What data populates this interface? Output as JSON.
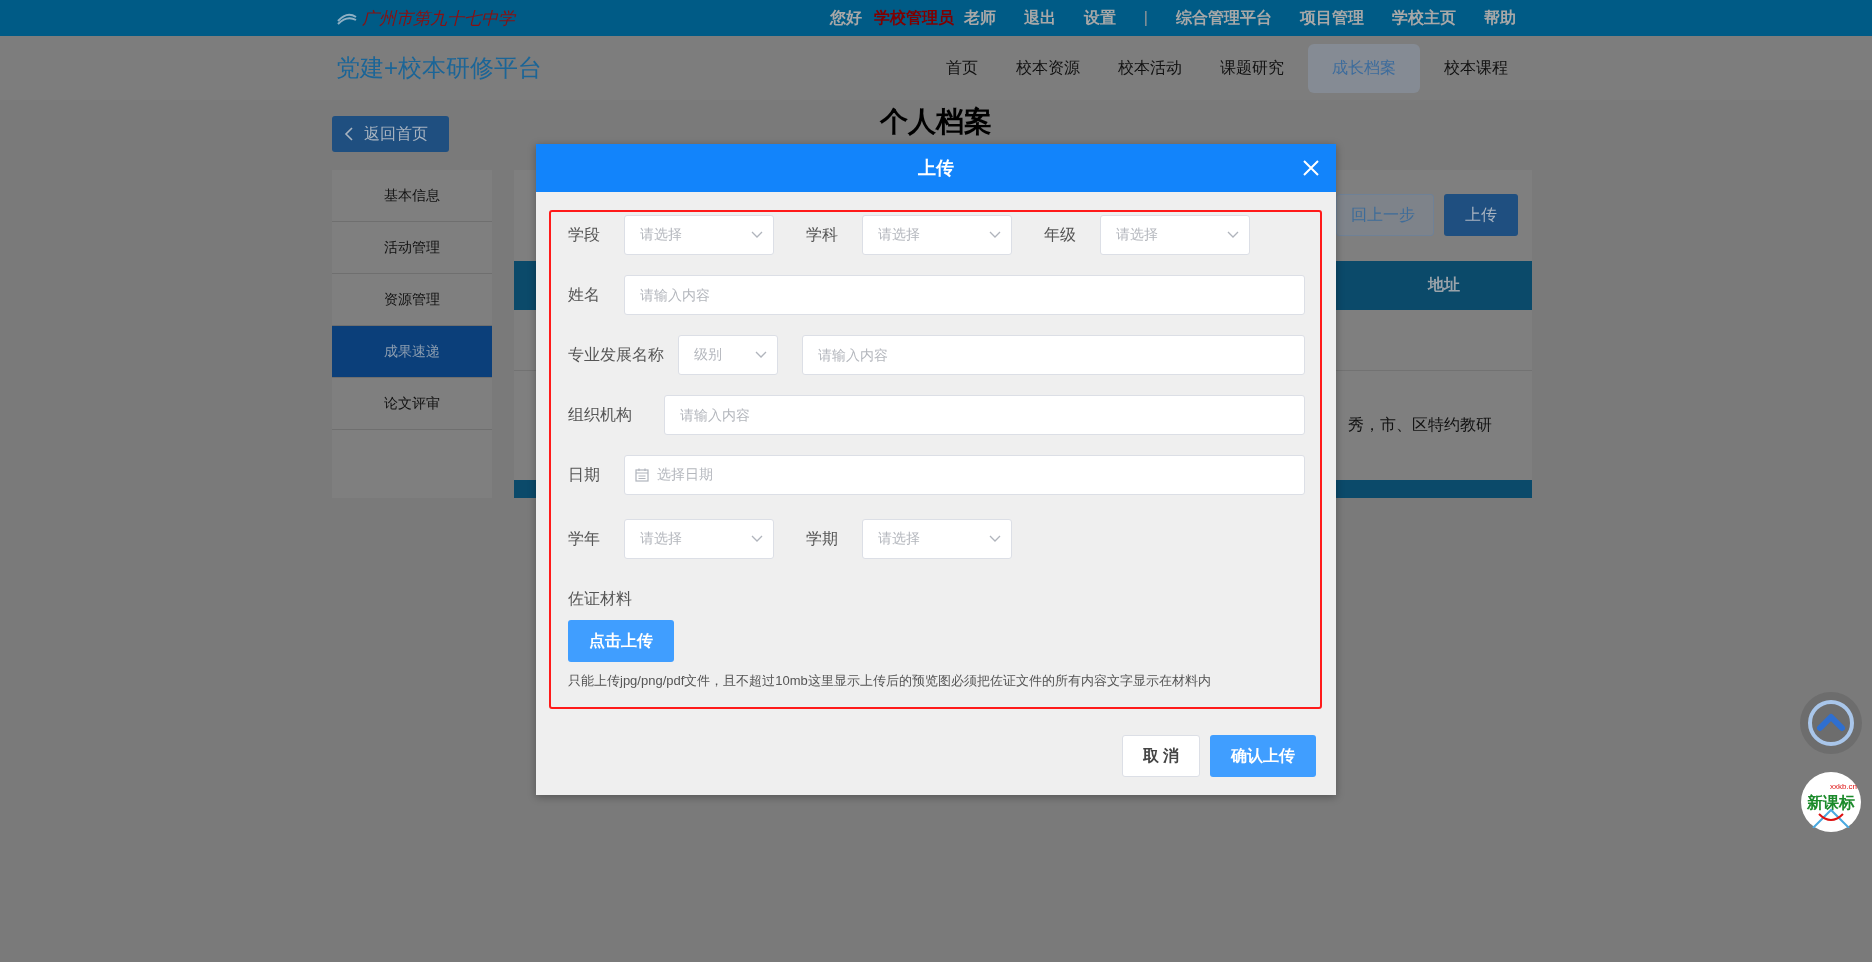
{
  "top_bar": {
    "school_name": "广州市第九十七中学",
    "greeting": "您好",
    "role": "学校管理员",
    "user_title": "老师",
    "links_left": [
      "退出",
      "设置"
    ],
    "separator": "|",
    "links_right": [
      "综合管理平台",
      "项目管理",
      "学校主页",
      "帮助"
    ]
  },
  "nav": {
    "site_title": "党建+校本研修平台",
    "items": [
      {
        "label": "首页",
        "selected": false
      },
      {
        "label": "校本资源",
        "selected": false
      },
      {
        "label": "校本活动",
        "selected": false
      },
      {
        "label": "课题研究",
        "selected": false
      },
      {
        "label": "成长档案",
        "selected": true
      },
      {
        "label": "校本课程",
        "selected": false
      }
    ]
  },
  "page": {
    "back_button": "返回首页",
    "heading": "个人档案",
    "sidebar": [
      {
        "label": "基本信息",
        "selected": false
      },
      {
        "label": "活动管理",
        "selected": false
      },
      {
        "label": "资源管理",
        "selected": false
      },
      {
        "label": "成果速递",
        "selected": true
      },
      {
        "label": "论文评审",
        "selected": false
      }
    ],
    "toolbar": {
      "back_step_button": "回上一步",
      "upload_button": "上传"
    },
    "table": {
      "column_header": "地址",
      "row_text": "秀，市、区特约教研"
    }
  },
  "modal": {
    "title": "上传",
    "rows": [
      {
        "fields": [
          {
            "kind": "select",
            "label": "学段",
            "placeholder": "请选择"
          },
          {
            "kind": "select",
            "label": "学科",
            "placeholder": "请选择"
          },
          {
            "kind": "select",
            "label": "年级",
            "placeholder": "请选择"
          }
        ]
      },
      {
        "fields": [
          {
            "kind": "input",
            "label": "姓名",
            "placeholder": "请输入内容"
          }
        ]
      },
      {
        "fields": [
          {
            "kind": "compact-select",
            "label": "专业发展名称",
            "placeholder": "级别"
          },
          {
            "kind": "input",
            "placeholder": "请输入内容"
          }
        ]
      },
      {
        "fields": [
          {
            "kind": "input",
            "label": "组织机构",
            "placeholder": "请输入内容"
          }
        ]
      },
      {
        "fields": [
          {
            "kind": "date",
            "label": "日期",
            "placeholder": "选择日期"
          }
        ]
      },
      {
        "fields": [
          {
            "kind": "select",
            "label": "学年",
            "placeholder": "请选择"
          },
          {
            "kind": "select",
            "label": "学期",
            "placeholder": "请选择"
          }
        ]
      }
    ],
    "evidence_label": "佐证材料",
    "upload_button": "点击上传",
    "hint": "只能上传jpg/png/pdf文件，且不超过10mb这里显示上传后的预览图必须把佐证文件的所有内容文字显示在材料内",
    "cancel_button": "取 消",
    "confirm_button": "确认上传"
  },
  "float_logo": {
    "text": "新课标",
    "domain": "xxkb.cn"
  }
}
